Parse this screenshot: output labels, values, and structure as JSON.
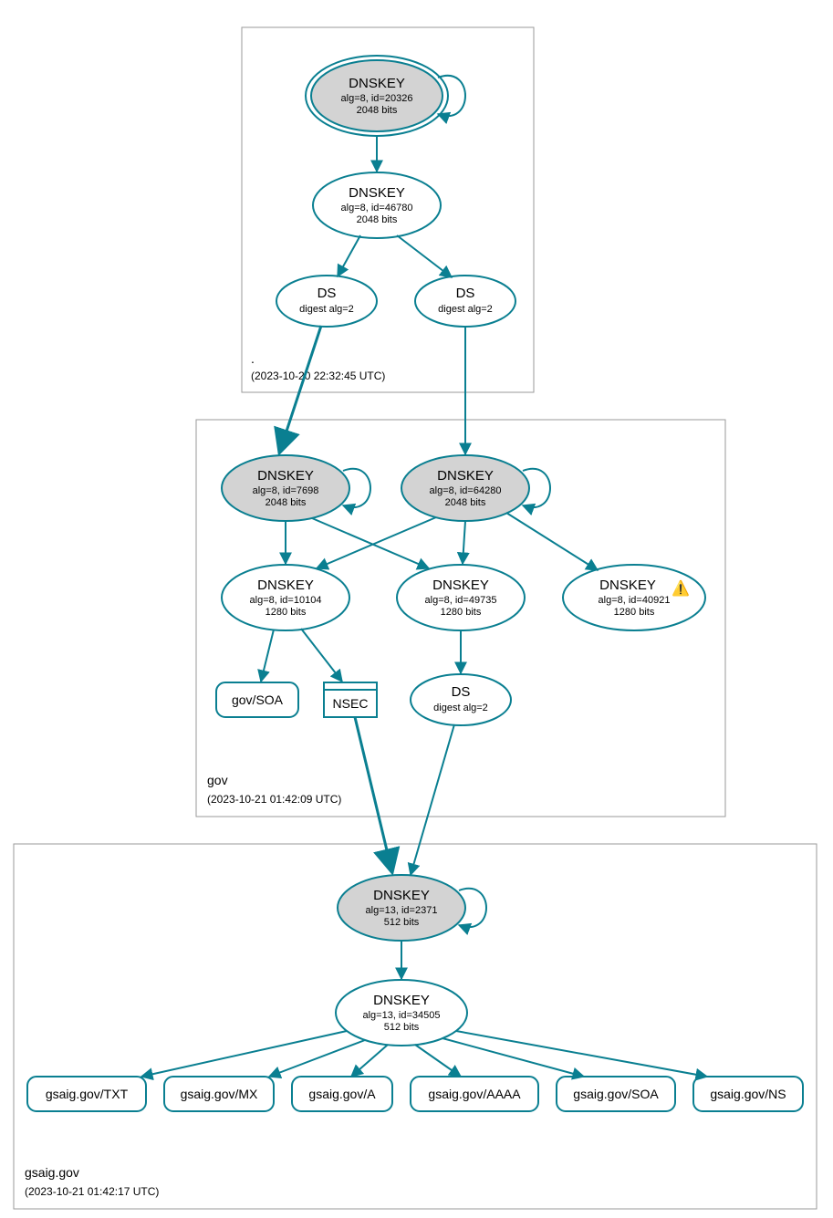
{
  "colors": {
    "stroke": "#0a7f91",
    "shaded": "#d3d3d3",
    "box": "#9a9a9a"
  },
  "zones": {
    "root": {
      "name": ".",
      "timestamp": "(2023-10-20 22:32:45 UTC)"
    },
    "gov": {
      "name": "gov",
      "timestamp": "(2023-10-21 01:42:09 UTC)"
    },
    "gsaig": {
      "name": "gsaig.gov",
      "timestamp": "(2023-10-21 01:42:17 UTC)"
    }
  },
  "nodes": {
    "root_ksk": {
      "title": "DNSKEY",
      "line2": "alg=8, id=20326",
      "line3": "2048 bits"
    },
    "root_zsk": {
      "title": "DNSKEY",
      "line2": "alg=8, id=46780",
      "line3": "2048 bits"
    },
    "root_ds1": {
      "title": "DS",
      "line2": "digest alg=2"
    },
    "root_ds2": {
      "title": "DS",
      "line2": "digest alg=2"
    },
    "gov_ksk1": {
      "title": "DNSKEY",
      "line2": "alg=8, id=7698",
      "line3": "2048 bits"
    },
    "gov_ksk2": {
      "title": "DNSKEY",
      "line2": "alg=8, id=64280",
      "line3": "2048 bits"
    },
    "gov_zsk1": {
      "title": "DNSKEY",
      "line2": "alg=8, id=10104",
      "line3": "1280 bits"
    },
    "gov_zsk2": {
      "title": "DNSKEY",
      "line2": "alg=8, id=49735",
      "line3": "1280 bits"
    },
    "gov_zsk3": {
      "title": "DNSKEY",
      "warn": "⚠️",
      "line2": "alg=8, id=40921",
      "line3": "1280 bits"
    },
    "gov_ds": {
      "title": "DS",
      "line2": "digest alg=2"
    },
    "gov_soa": {
      "label": "gov/SOA"
    },
    "gov_nsec": {
      "label": "NSEC"
    },
    "gsaig_ksk": {
      "title": "DNSKEY",
      "line2": "alg=13, id=2371",
      "line3": "512 bits"
    },
    "gsaig_zsk": {
      "title": "DNSKEY",
      "line2": "alg=13, id=34505",
      "line3": "512 bits"
    },
    "rr_txt": {
      "label": "gsaig.gov/TXT"
    },
    "rr_mx": {
      "label": "gsaig.gov/MX"
    },
    "rr_a": {
      "label": "gsaig.gov/A"
    },
    "rr_aaaa": {
      "label": "gsaig.gov/AAAA"
    },
    "rr_soa": {
      "label": "gsaig.gov/SOA"
    },
    "rr_ns": {
      "label": "gsaig.gov/NS"
    }
  }
}
